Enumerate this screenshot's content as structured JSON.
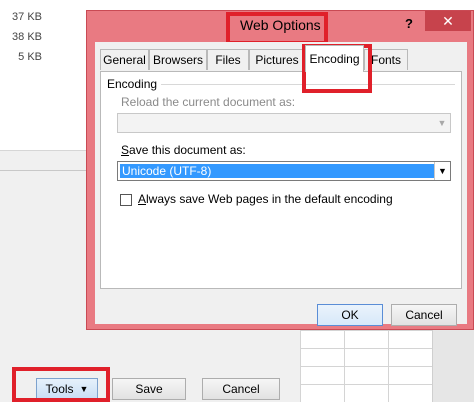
{
  "background": {
    "file_sizes": [
      "37 KB",
      "38 KB",
      "5 KB"
    ],
    "buttons": {
      "tools_label": "Tools",
      "save_label": "Save",
      "cancel_label": "Cancel"
    }
  },
  "dialog": {
    "title": "Web Options",
    "help_icon": "?",
    "close_icon": "✕",
    "tabs": [
      {
        "label": "General"
      },
      {
        "label": "Browsers"
      },
      {
        "label": "Files"
      },
      {
        "label": "Pictures"
      },
      {
        "label": "Encoding",
        "selected": true
      },
      {
        "label": "Fonts"
      }
    ],
    "encoding": {
      "group_label": "Encoding",
      "reload_label": "Reload the current document as:",
      "reload_value": "",
      "save_label_accel": "S",
      "save_label_rest": "ave this document as:",
      "save_value": "Unicode (UTF-8)",
      "always_save_accel": "A",
      "always_save_rest": "lways save Web pages in the default encoding",
      "always_save_checked": false
    },
    "ok_label": "OK",
    "cancel_label": "Cancel"
  },
  "highlight_color": "#e0202a"
}
